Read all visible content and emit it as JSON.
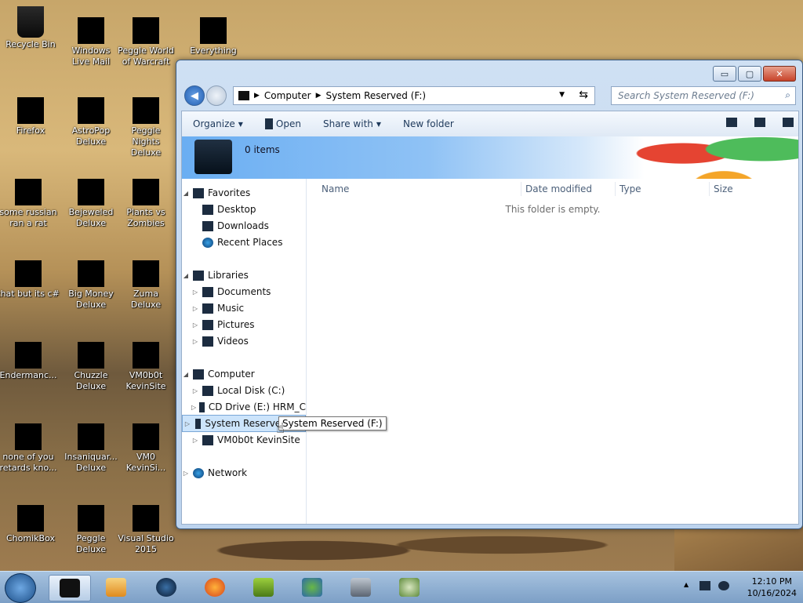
{
  "desktop": {
    "icons": [
      {
        "label": "Recycle Bin"
      },
      {
        "label": "Windows Live Mail"
      },
      {
        "label": "Peggle World of Warcraft"
      },
      {
        "label": "Everything"
      },
      {
        "label": "Firefox"
      },
      {
        "label": "AstroPop Deluxe"
      },
      {
        "label": "Peggle Nights Deluxe"
      },
      {
        "label": "some russian ran a rat"
      },
      {
        "label": "Bejeweled Deluxe"
      },
      {
        "label": "Plants vs Zombies"
      },
      {
        "label": "that but its c#"
      },
      {
        "label": "Big Money Deluxe"
      },
      {
        "label": "Zuma Deluxe"
      },
      {
        "label": "Endermanc..."
      },
      {
        "label": "Chuzzle Deluxe"
      },
      {
        "label": "VM0b0t KevinSite"
      },
      {
        "label": "none of you retards kno..."
      },
      {
        "label": "Insaniquar... Deluxe"
      },
      {
        "label": "VM0 KevinSi..."
      },
      {
        "label": "ChomikBox"
      },
      {
        "label": "Peggle Deluxe"
      },
      {
        "label": "Visual Studio 2015"
      }
    ]
  },
  "window": {
    "caption": {
      "minimize": "▭",
      "maximize": "▢",
      "close": "✕"
    },
    "address": {
      "crumbs": [
        "Computer",
        "System Reserved (F:)"
      ]
    },
    "search": {
      "placeholder": "Search System Reserved (F:)"
    },
    "toolbar": {
      "organize": "Organize",
      "open": "Open",
      "share_with": "Share with",
      "new_folder": "New folder"
    },
    "details": {
      "items": "0 items"
    },
    "nav": {
      "favorites": "Favorites",
      "desktop": "Desktop",
      "downloads": "Downloads",
      "recent": "Recent Places",
      "libraries": "Libraries",
      "documents": "Documents",
      "music": "Music",
      "pictures": "Pictures",
      "videos": "Videos",
      "computer": "Computer",
      "local_disk": "Local Disk (C:)",
      "cd_drive": "CD Drive (E:) HRM_C",
      "system_reserved": "System Reserved (F:)",
      "vm0b0t": "VM0b0t KevinSite",
      "network": "Network"
    },
    "tooltip": "System Reserved (F:)",
    "columns": {
      "name": "Name",
      "date": "Date modified",
      "type": "Type",
      "size": "Size"
    },
    "empty_text": "This folder is empty."
  },
  "taskbar": {
    "time": "12:10 PM",
    "date": "10/16/2024"
  }
}
